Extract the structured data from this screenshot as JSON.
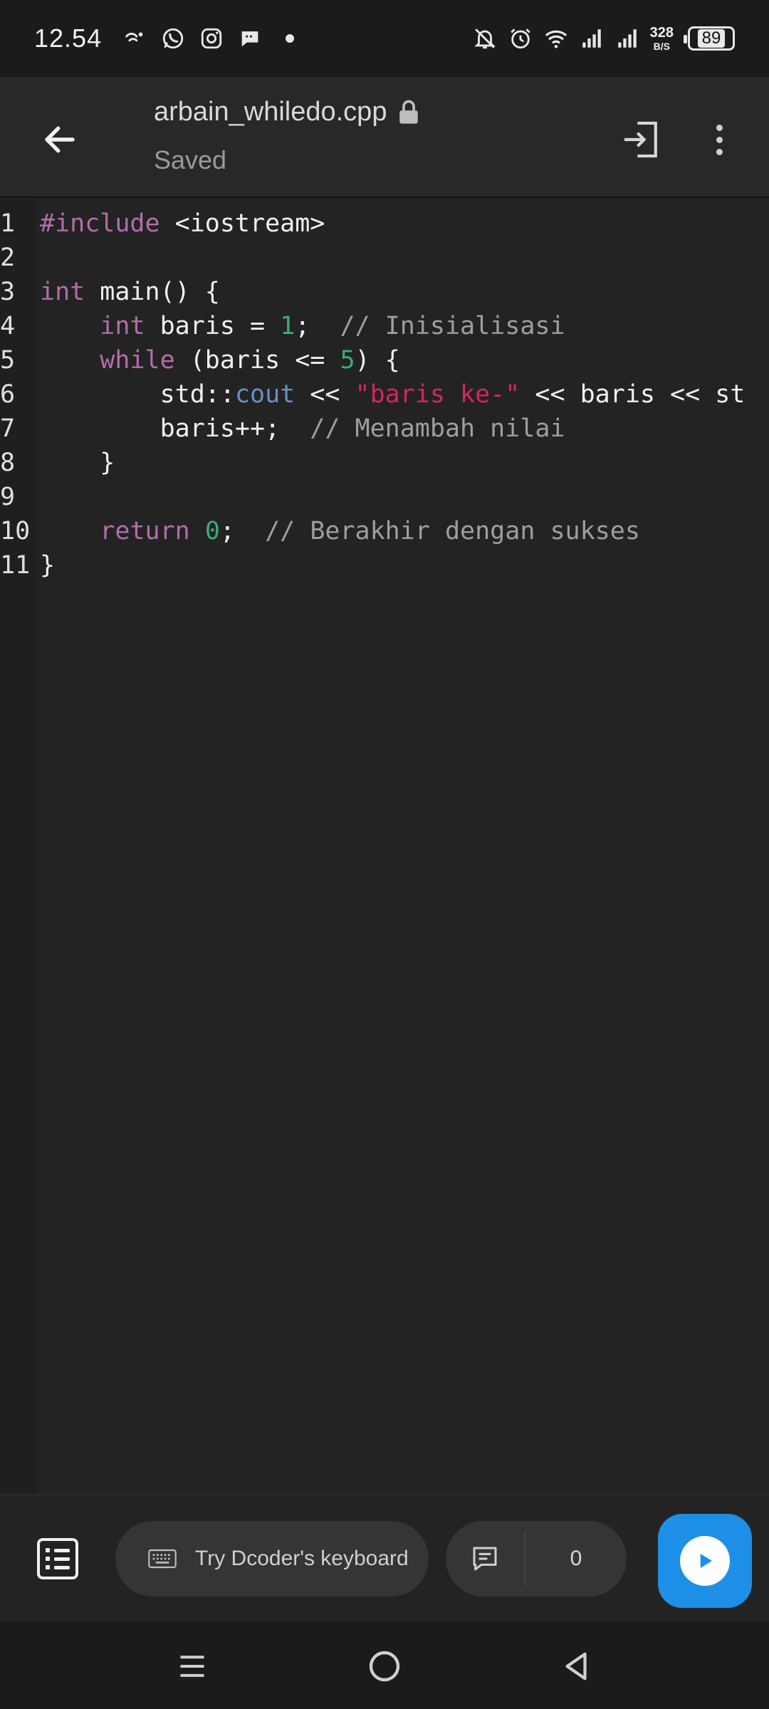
{
  "status_bar": {
    "time": "12.54",
    "net_speed_value": "328",
    "net_speed_unit": "B/S",
    "battery": "89",
    "icons_left": [
      "tiktok-icon",
      "whatsapp-icon",
      "instagram-icon",
      "message-icon"
    ],
    "icons_right": [
      "bell-off-icon",
      "alarm-icon",
      "wifi-icon",
      "signal-icon",
      "signal-icon"
    ]
  },
  "app_bar": {
    "file_name": "arbain_whiledo.cpp",
    "status": "Saved"
  },
  "editor": {
    "lines": [
      {
        "n": "1",
        "tokens": [
          {
            "t": "#include",
            "c": "kw"
          },
          {
            "t": " <iostream>",
            "c": ""
          }
        ]
      },
      {
        "n": "2",
        "tokens": []
      },
      {
        "n": "3",
        "tokens": [
          {
            "t": "int",
            "c": "kw"
          },
          {
            "t": " main() {",
            "c": ""
          }
        ]
      },
      {
        "n": "4",
        "tokens": [
          {
            "t": "    ",
            "c": ""
          },
          {
            "t": "int",
            "c": "kw"
          },
          {
            "t": " baris = ",
            "c": ""
          },
          {
            "t": "1",
            "c": "num"
          },
          {
            "t": ";  ",
            "c": ""
          },
          {
            "t": "// Inisialisasi",
            "c": "cmt"
          }
        ]
      },
      {
        "n": "5",
        "tokens": [
          {
            "t": "    ",
            "c": ""
          },
          {
            "t": "while",
            "c": "kw"
          },
          {
            "t": " (baris <= ",
            "c": ""
          },
          {
            "t": "5",
            "c": "num"
          },
          {
            "t": ") {",
            "c": ""
          }
        ]
      },
      {
        "n": "6",
        "tokens": [
          {
            "t": "        std::",
            "c": ""
          },
          {
            "t": "cout",
            "c": "typ"
          },
          {
            "t": " << ",
            "c": ""
          },
          {
            "t": "\"baris ke-\"",
            "c": "str"
          },
          {
            "t": " << baris << st",
            "c": ""
          }
        ]
      },
      {
        "n": "7",
        "tokens": [
          {
            "t": "        baris++;  ",
            "c": ""
          },
          {
            "t": "// Menambah nilai",
            "c": "cmt"
          }
        ]
      },
      {
        "n": "8",
        "tokens": [
          {
            "t": "    }",
            "c": ""
          }
        ]
      },
      {
        "n": "9",
        "tokens": []
      },
      {
        "n": "10",
        "tokens": [
          {
            "t": "    ",
            "c": ""
          },
          {
            "t": "return",
            "c": "kw"
          },
          {
            "t": " ",
            "c": ""
          },
          {
            "t": "0",
            "c": "num"
          },
          {
            "t": ";  ",
            "c": ""
          },
          {
            "t": "// Berakhir dengan sukses",
            "c": "cmt"
          }
        ]
      },
      {
        "n": "11",
        "tokens": [
          {
            "t": "}",
            "c": ""
          }
        ]
      }
    ]
  },
  "toolbar": {
    "keyboard_label": "Try Dcoder's keyboard",
    "comment_count": "0"
  },
  "nav_bar": {
    "buttons": [
      "menu-icon",
      "home-icon",
      "back-icon"
    ]
  }
}
